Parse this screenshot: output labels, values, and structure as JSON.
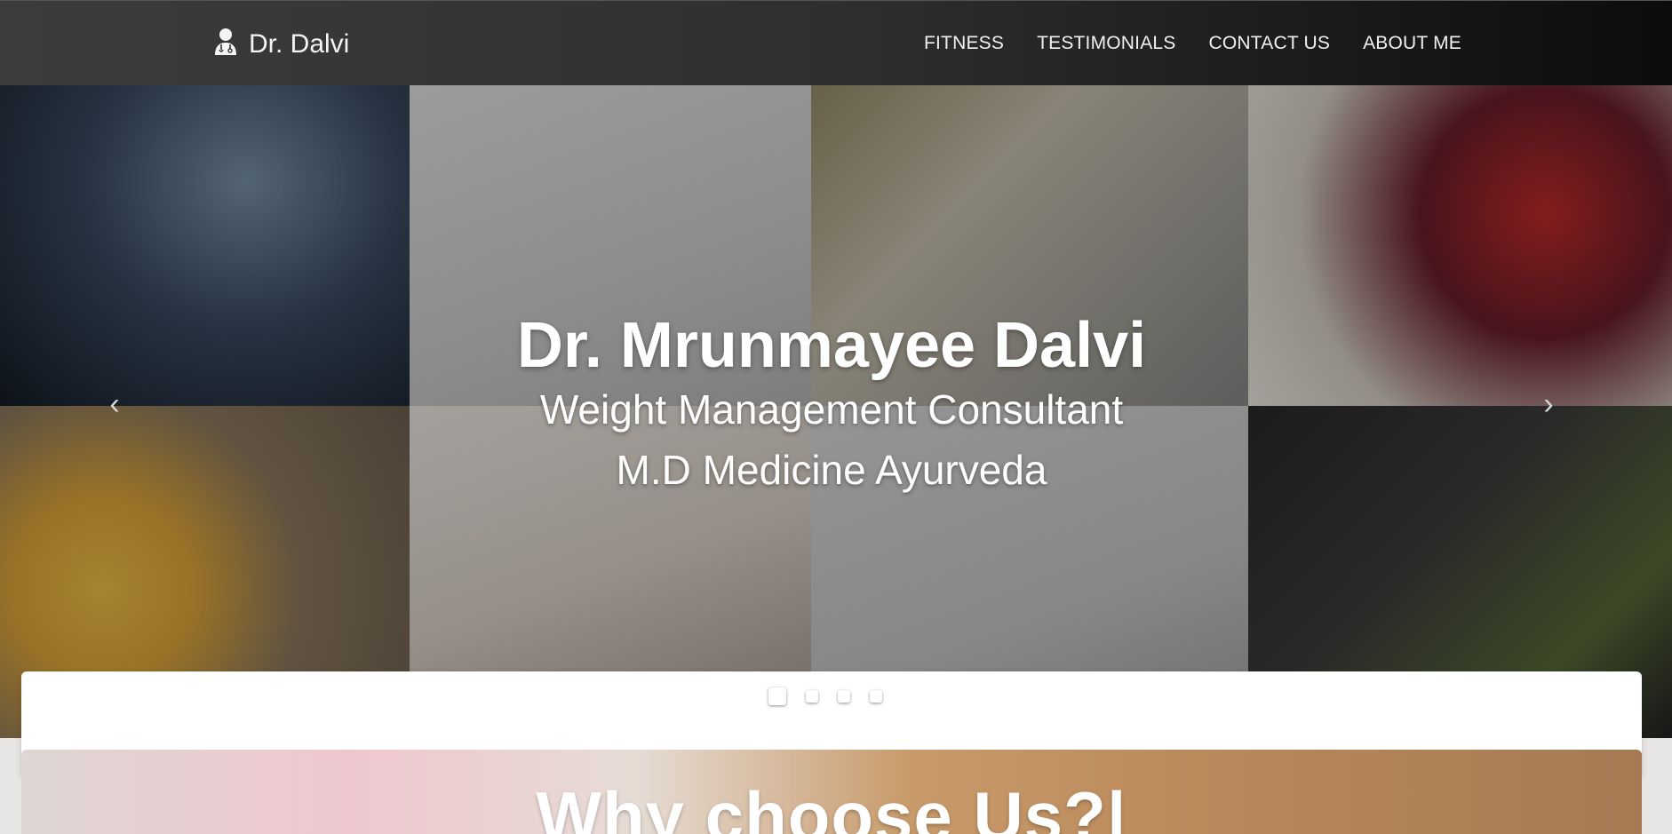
{
  "navbar": {
    "brand_icon": "doctor-icon",
    "brand_text": "Dr. Dalvi",
    "links": [
      "FITNESS",
      "TESTIMONIALS",
      "CONTACT US",
      "ABOUT ME"
    ]
  },
  "hero": {
    "title": "Dr. Mrunmayee Dalvi",
    "subtitle_1": "Weight Management Consultant",
    "subtitle_2": "M.D Medicine Ayurveda",
    "prev_icon": "chevron-left-icon",
    "next_icon": "chevron-right-icon",
    "slide_count": 4,
    "active_slide": 1
  },
  "why_section": {
    "title": "Why choose Us?|"
  },
  "colors": {
    "navbar_bg": "#2f2f2f",
    "text_light": "#ffffff"
  }
}
